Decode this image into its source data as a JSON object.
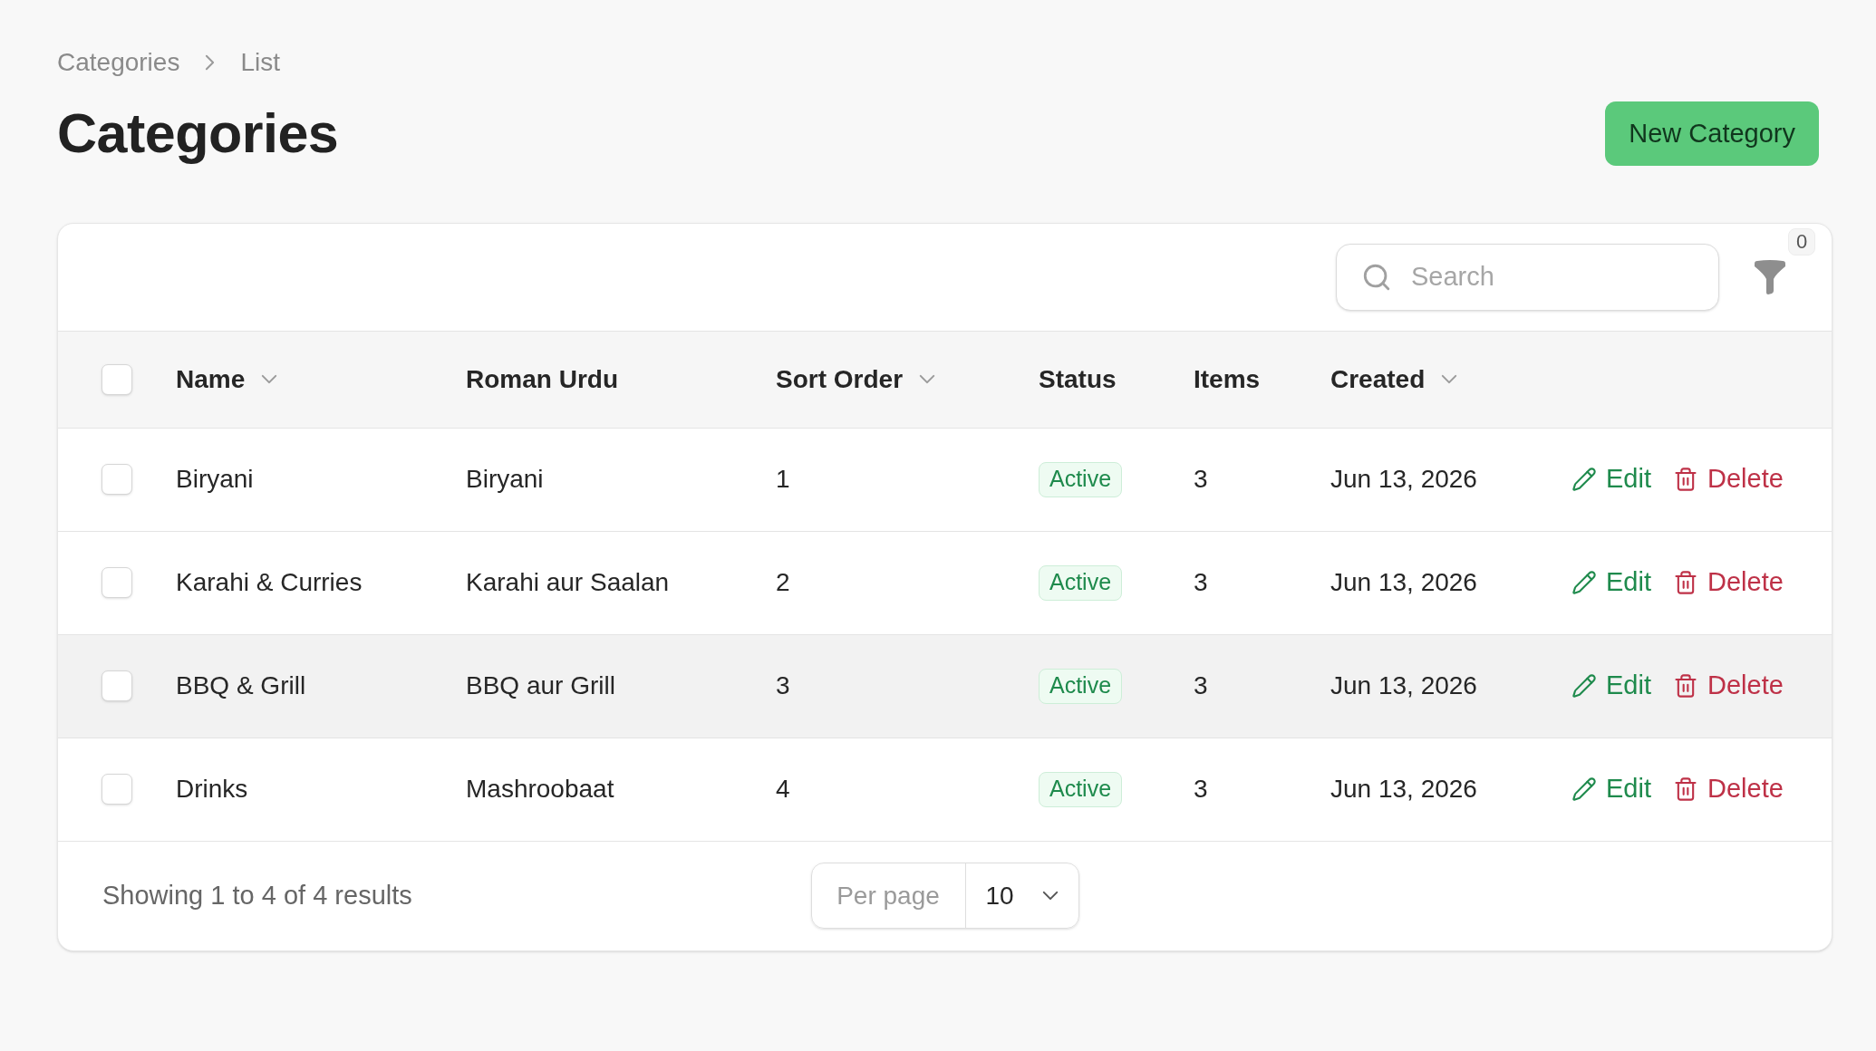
{
  "breadcrumbs": [
    "Categories",
    "List"
  ],
  "page_title": "Categories",
  "header_action": {
    "label": "New Category"
  },
  "toolbar": {
    "search": {
      "placeholder": "Search"
    },
    "filter_count": "0"
  },
  "table": {
    "select_all": {
      "checked": false
    },
    "columns": [
      {
        "label": "Name",
        "sortable": true
      },
      {
        "label": "Roman Urdu",
        "sortable": false
      },
      {
        "label": "Sort Order",
        "sortable": true
      },
      {
        "label": "Status",
        "sortable": false
      },
      {
        "label": "Items",
        "sortable": false
      },
      {
        "label": "Created",
        "sortable": true
      }
    ],
    "rows": [
      {
        "checked": false,
        "highlighted": false,
        "name": "Biryani",
        "roman_urdu": "Biryani",
        "sort_order": "1",
        "status": "Active",
        "items": "3",
        "created": "Jun 13, 2026",
        "actions": [
          {
            "kind": "edit",
            "label": "Edit"
          },
          {
            "kind": "delete",
            "label": "Delete"
          }
        ]
      },
      {
        "checked": false,
        "highlighted": false,
        "name": "Karahi & Curries",
        "roman_urdu": "Karahi aur Saalan",
        "sort_order": "2",
        "status": "Active",
        "items": "3",
        "created": "Jun 13, 2026",
        "actions": [
          {
            "kind": "edit",
            "label": "Edit"
          },
          {
            "kind": "delete",
            "label": "Delete"
          }
        ]
      },
      {
        "checked": false,
        "highlighted": true,
        "name": "BBQ & Grill",
        "roman_urdu": "BBQ aur Grill",
        "sort_order": "3",
        "status": "Active",
        "items": "3",
        "created": "Jun 13, 2026",
        "actions": [
          {
            "kind": "edit",
            "label": "Edit"
          },
          {
            "kind": "delete",
            "label": "Delete"
          }
        ]
      },
      {
        "checked": false,
        "highlighted": false,
        "name": "Drinks",
        "roman_urdu": "Mashroobaat",
        "sort_order": "4",
        "status": "Active",
        "items": "3",
        "created": "Jun 13, 2026",
        "actions": [
          {
            "kind": "edit",
            "label": "Edit"
          },
          {
            "kind": "delete",
            "label": "Delete"
          }
        ]
      }
    ]
  },
  "pagination": {
    "summary": "Showing 1 to 4 of 4 results",
    "per_page_label": "Per page",
    "per_page_value": "10"
  }
}
